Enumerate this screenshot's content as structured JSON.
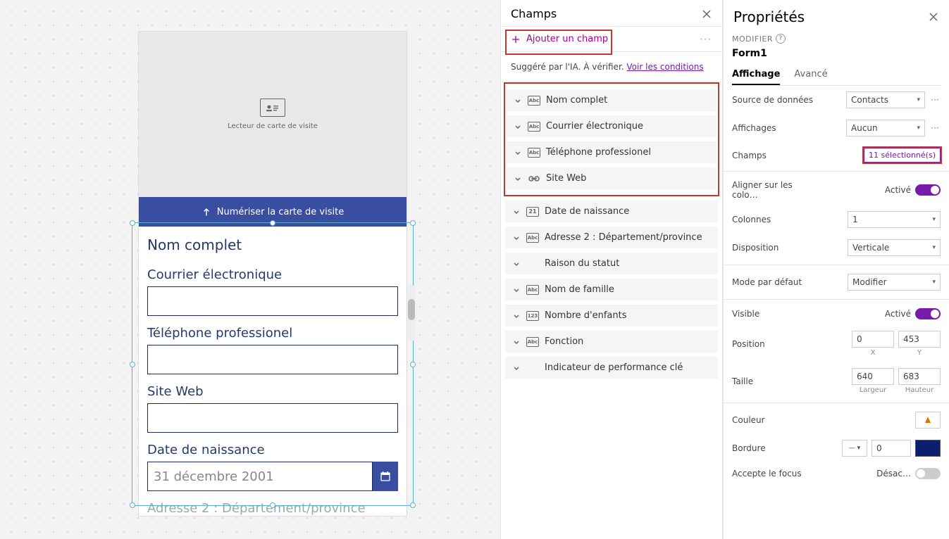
{
  "canvas": {
    "card_reader_label": "Lecteur de carte de visite",
    "scan_button": "Numériser la carte de visite",
    "form_title": "Nom complet",
    "labels": {
      "email": "Courrier électronique",
      "phone": "Téléphone professionel",
      "website": "Site Web",
      "dob": "Date de naissance",
      "addr2_partial": "Adresse 2 : Département/province"
    },
    "date_value": "31 décembre 2001"
  },
  "fields_panel": {
    "title": "Champs",
    "add_field": "Ajouter un champ",
    "more": "···",
    "suggest_prefix": "Suggéré par l'IA. À vérifier. ",
    "suggest_link": "Voir les conditions",
    "items": [
      {
        "icon": "abc",
        "label": "Nom complet",
        "hl": true
      },
      {
        "icon": "abc",
        "label": "Courrier électronique",
        "hl": true
      },
      {
        "icon": "abc",
        "label": "Téléphone professionel",
        "hl": true
      },
      {
        "icon": "link",
        "label": "Site Web",
        "hl": true
      },
      {
        "icon": "cal",
        "label": "Date de naissance"
      },
      {
        "icon": "abc",
        "label": "Adresse 2 : Département/province"
      },
      {
        "icon": "grid",
        "label": "Raison du statut"
      },
      {
        "icon": "abc",
        "label": "Nom de famille"
      },
      {
        "icon": "123",
        "label": "Nombre d'enfants"
      },
      {
        "icon": "abc",
        "label": "Fonction"
      },
      {
        "icon": "grid",
        "label": "Indicateur de performance clé"
      }
    ]
  },
  "props_panel": {
    "title": "Propriétés",
    "modifier": "MODIFIER",
    "form_name": "Form1",
    "tabs": {
      "display": "Affichage",
      "advanced": "Avancé"
    },
    "datasource": {
      "label": "Source de données",
      "value": "Contacts"
    },
    "views": {
      "label": "Affichages",
      "value": "Aucun"
    },
    "fields": {
      "label": "Champs",
      "value": "11 sélectionné(s)"
    },
    "snap": {
      "label": "Aligner sur les colo…",
      "state": "Activé"
    },
    "columns": {
      "label": "Colonnes",
      "value": "1"
    },
    "layout": {
      "label": "Disposition",
      "value": "Verticale"
    },
    "mode": {
      "label": "Mode par défaut",
      "value": "Modifier"
    },
    "visible": {
      "label": "Visible",
      "state": "Activé"
    },
    "position": {
      "label": "Position",
      "x": "0",
      "y": "453",
      "xl": "X",
      "yl": "Y"
    },
    "size": {
      "label": "Taille",
      "w": "640",
      "h": "683",
      "wl": "Largeur",
      "hl": "Hauteur"
    },
    "color": {
      "label": "Couleur"
    },
    "border": {
      "label": "Bordure",
      "width": "0"
    },
    "focus": {
      "label": "Accepte le focus",
      "state": "Désac…"
    }
  }
}
